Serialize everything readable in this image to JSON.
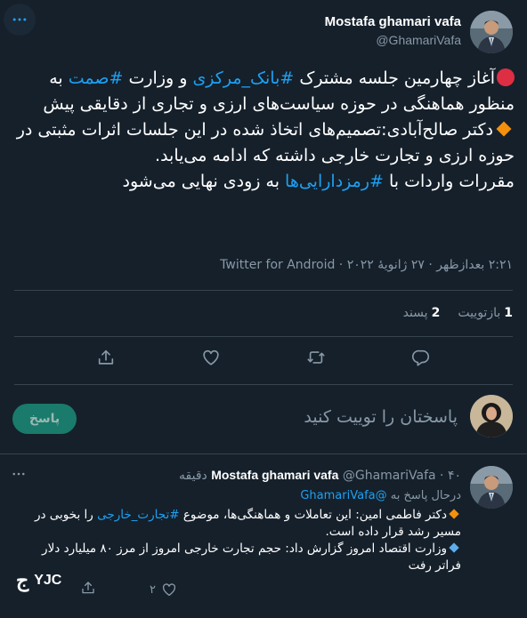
{
  "main_tweet": {
    "author_name": "Mostafa ghamari vafa",
    "author_handle": "@GhamariVafa",
    "line1_pre": "آغاز چهارمین جلسه مشترک ",
    "hashtag_bank": "#بانک_مرکزی",
    "line1_post": " و وزارت",
    "hashtag_samt": "#صمت",
    "line2": " به منظور هماهنگی در حوزه سیاست‌های ارزی و تجاری از دقایقی پیش",
    "line3": "دکتر صالح‌آبادی:تصمیم‌های اتخاذ شده در این جلسات اثرات مثبتی در حوزه ارزی و تجارت خارجی داشته که ادامه می‌یابد.",
    "line4_pre": "مقررات واردات با ",
    "hashtag_crypto": "#رمزدارایی‌ها",
    "line4_post": " به زودی نهایی می‌شود",
    "meta": "۲:۲۱ بعدازظهر · ۲۷ ژانویهٔ ۲۰۲۲ · Twitter for Android",
    "retweets_count": "1",
    "retweets_label": "بازتوییت",
    "likes_count": "2",
    "likes_label": "پسند"
  },
  "reply_box": {
    "placeholder": "پاسختان را توییت کنید",
    "button_label": "پاسخ"
  },
  "reply_tweet": {
    "author_name": "Mostafa ghamari vafa",
    "author_handle": "@GhamariVafa",
    "time": "۴۰ دقیقه",
    "replying_to_label": "درحال پاسخ به",
    "replying_to_handle": "@GhamariVafa",
    "p1_pre": "دکتر فاطمی امین: این تعاملات و هماهنگی‌ها، موضوع ",
    "p1_hashtag": "#تجارت_خارجی",
    "p1_post": " را بخوبی در مسیر رشد قرار داده است.",
    "p2": "وزارت اقتصاد امروز گزارش داد: حجم تجارت خارجی امروز از مرز ۸۰ میلیارد دلار فراتر رفت",
    "like_count": "۲"
  },
  "watermark": {
    "text": "YJC"
  },
  "colors": {
    "background": "#15202b",
    "accent": "#1da1f2",
    "muted": "#8899a6",
    "divider": "#38444d",
    "red_circle": "#dd2e44",
    "orange_diamond": "#f4900c",
    "blue_diamond": "#5dadec"
  },
  "icons": [
    "more-icon",
    "reply-icon",
    "retweet-icon",
    "like-icon",
    "share-icon",
    "red-circle-emoji",
    "orange-diamond-emoji",
    "blue-diamond-emoji"
  ]
}
